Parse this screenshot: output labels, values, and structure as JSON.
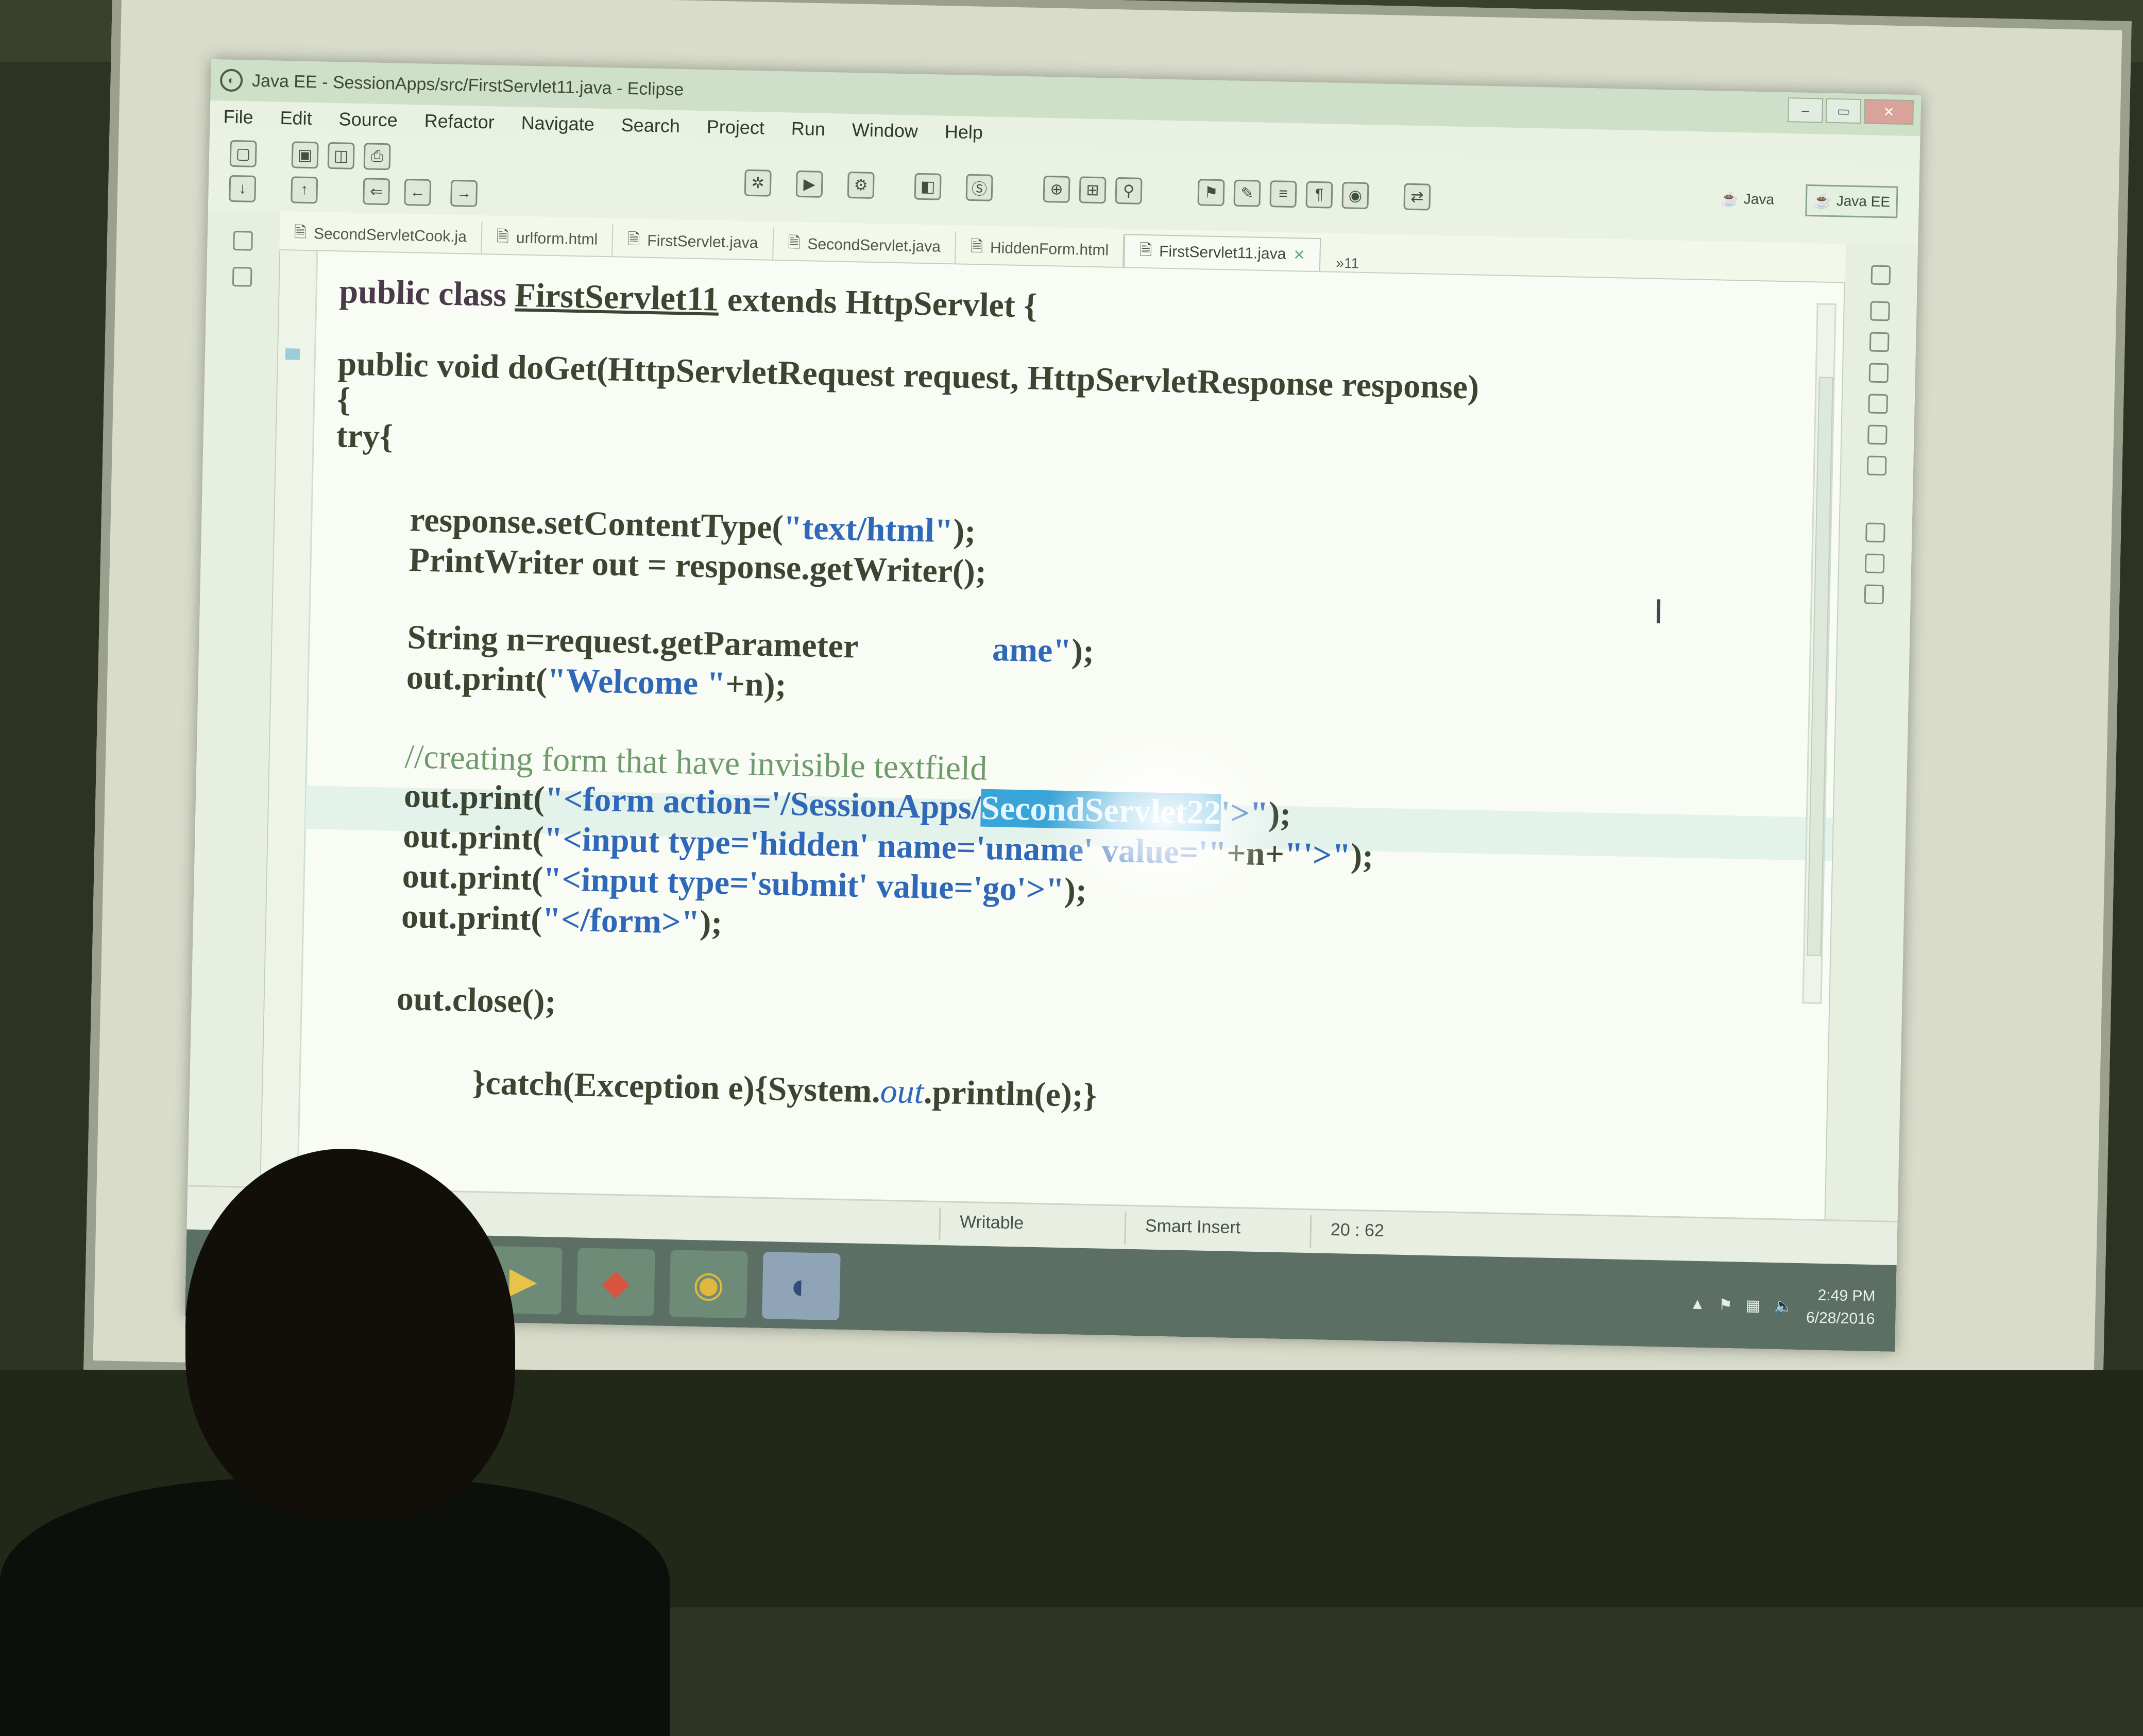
{
  "window": {
    "title": "Java EE - SessionApps/src/FirstServlet11.java - Eclipse"
  },
  "menu": [
    "File",
    "Edit",
    "Source",
    "Refactor",
    "Navigate",
    "Search",
    "Project",
    "Run",
    "Window",
    "Help"
  ],
  "perspectives": {
    "java": "Java",
    "java_ee": "Java EE"
  },
  "tabs": [
    {
      "label": "SecondServletCook.ja"
    },
    {
      "label": "urlform.html"
    },
    {
      "label": "FirstServlet.java"
    },
    {
      "label": "SecondServlet.java"
    },
    {
      "label": "HiddenForm.html"
    },
    {
      "label": "FirstServlet11.java",
      "active": true
    }
  ],
  "tab_overflow": "»11",
  "code": {
    "l1_a": "public class ",
    "l1_b": "FirstServlet11",
    "l1_c": " extends HttpServlet {",
    "l2": "public void doGet(HttpServletRequest request, HttpServletResponse response)",
    "l3": "{",
    "l4": "try{",
    "l5_a": "response.setContentType(",
    "l5_b": "\"text/html\"",
    "l5_c": ");",
    "l6": "PrintWriter out = response.getWriter();",
    "l7_a": "String n=request.getParameter",
    "l7_b": "ame\"",
    "l7_c": ");",
    "l8_a": "out.print(",
    "l8_b": "\"Welcome \"",
    "l8_c": "+n);",
    "l9": "//creating form that have invisible textfield",
    "l10_a": "out.print(",
    "l10_b": "\"<form action='/SessionApps/",
    "l10_sel": "SecondServlet22",
    "l10_c": "'>\"",
    "l10_d": ");",
    "l11_a": "out.print(",
    "l11_b": "\"<input type='hidden' name='uname' value='\"",
    "l11_c": "+n+",
    "l11_d": "\"'>\"",
    "l11_e": ");",
    "l12_a": "out.print(",
    "l12_b": "\"<input type='submit' value='go'>\"",
    "l12_c": ");",
    "l13_a": "out.print(",
    "l13_b": "\"</form>\"",
    "l13_c": ");",
    "l14": "out.close();",
    "l15_a": "}catch(Exception e){System.",
    "l15_b": "out",
    "l15_c": ".println(e);}"
  },
  "status": {
    "mode": "Writable",
    "insert": "Smart Insert",
    "position": "20 : 62"
  },
  "clock": {
    "time": "2:49 PM",
    "date": "6/28/2016"
  }
}
